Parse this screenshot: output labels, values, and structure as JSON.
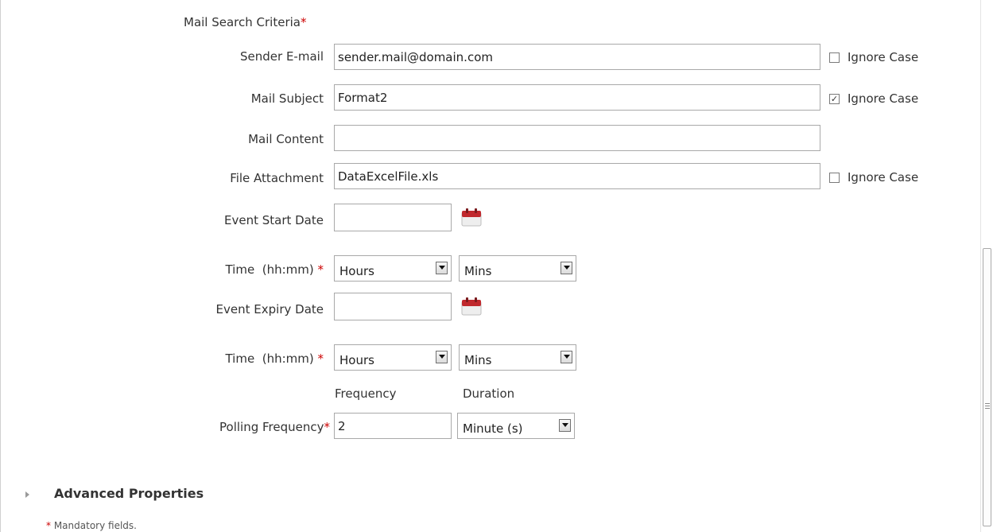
{
  "section_title": "Mail Search Criteria",
  "required_marker": "*",
  "ignore_case_label": "Ignore Case",
  "fields": {
    "sender_email": {
      "label": "Sender E-mail",
      "value": "sender.mail@domain.com",
      "ignore_case": false
    },
    "mail_subject": {
      "label": "Mail Subject",
      "value": "Format2",
      "ignore_case": true
    },
    "mail_content": {
      "label": "Mail Content",
      "value": ""
    },
    "file_attachment": {
      "label": "File Attachment",
      "value": "DataExcelFile.xls",
      "ignore_case": false
    },
    "event_start_date": {
      "label": "Event Start Date",
      "value": ""
    },
    "start_time": {
      "label": "Time  (hh:mm)",
      "hours": "Hours",
      "mins": "Mins"
    },
    "event_expiry_date": {
      "label": "Event Expiry Date",
      "value": ""
    },
    "expiry_time": {
      "label": "Time  (hh:mm)",
      "hours": "Hours",
      "mins": "Mins"
    },
    "polling": {
      "frequency_header": "Frequency",
      "duration_header": "Duration",
      "label": "Polling Frequency",
      "frequency_value": "2",
      "duration_value": "Minute (s)"
    }
  },
  "advanced_properties": "Advanced Properties",
  "footnote": "Mandatory fields.",
  "icons": {
    "calendar": "calendar-icon",
    "dropdown": "chevron-down-icon",
    "expand": "expand-arrow-icon"
  },
  "colors": {
    "required": "#cc0000",
    "calendar": "#c0282d"
  }
}
